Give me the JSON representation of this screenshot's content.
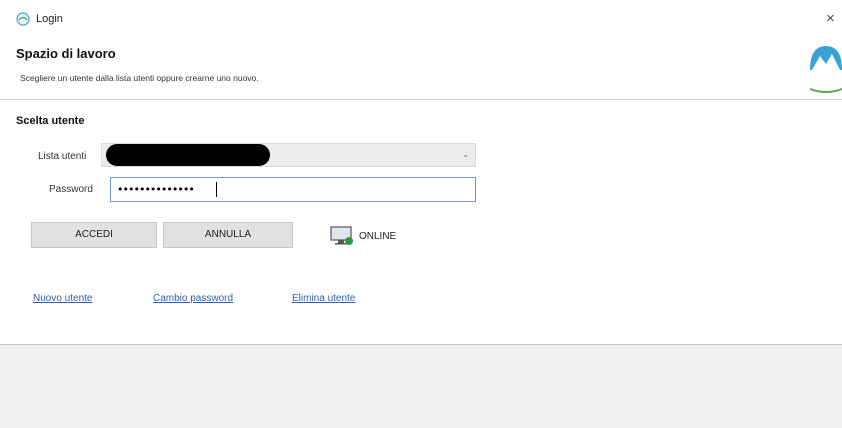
{
  "window": {
    "title": "Login",
    "close_glyph": "×"
  },
  "header": {
    "title": "Spazio di lavoro",
    "subtitle": "Scegliere un utente dalla lista utenti oppure crearne uno nuovo."
  },
  "form": {
    "section_title": "Scelta utente",
    "user_list_label": "Lista utenti",
    "user_list_value": "",
    "password_label": "Password",
    "password_value": "••••••••••••••"
  },
  "buttons": {
    "accedi": "ACCEDI",
    "annulla": "ANNULLA"
  },
  "status": {
    "text": "ONLINE",
    "icon": "monitor-online-icon",
    "color": "#2e9b3e"
  },
  "links": {
    "nuovo_utente": "Nuovo utente",
    "cambio_password": "Cambio password",
    "elimina_utente": "Elimina utente"
  },
  "colors": {
    "link": "#2b5fb3",
    "logo_blue": "#3aa3d6",
    "logo_green": "#58a745"
  }
}
